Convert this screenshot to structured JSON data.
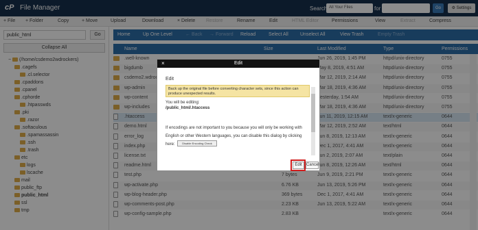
{
  "header": {
    "logo": "cP",
    "title": "File Manager",
    "search_label": "Search",
    "search_scope": "All Your Files",
    "for_label": "for",
    "go": "Go",
    "settings": "Settings"
  },
  "toolbar": [
    "+ File",
    "+ Folder",
    "Copy",
    "+ Move",
    "Upload",
    "Download",
    "× Delete",
    "Restore",
    "Rename",
    "Edit",
    "HTML Editor",
    "Permissions",
    "View",
    "Extract",
    "Compress"
  ],
  "sidebar": {
    "path": "public_html",
    "go": "Go",
    "collapse": "Collapse All",
    "tree": [
      "(/home/csdemo2wdrockers)",
      ".cagefs",
      ".cl.selector",
      ".cpaddons",
      ".cpanel",
      ".cphorde",
      ".htpasswds",
      ".pki",
      ".razor",
      ".softaculous",
      ".spamassassin",
      ".ssh",
      ".trash",
      "etc",
      "logs",
      "lscache",
      "mail",
      "public_ftp",
      "public_html",
      "ssl",
      "tmp"
    ]
  },
  "actions": [
    "Home",
    "Up One Level",
    "← Back",
    "→ Forward",
    "Reload",
    "Select All",
    "Unselect All",
    "View Trash",
    "Empty Trash"
  ],
  "table": {
    "headers": [
      "Name",
      "Size",
      "Last Modified",
      "Type",
      "Permissions"
    ],
    "rows": [
      {
        "name": ".well-known",
        "size": "",
        "modified": "Jun 26, 2019, 1:45 PM",
        "type": "httpd/unix-directory",
        "perm": "0755"
      },
      {
        "name": "bigdumb",
        "size": "",
        "modified": "May 8, 2019, 4:51 AM",
        "type": "httpd/unix-directory",
        "perm": "0755"
      },
      {
        "name": "csdemo2.wdroc",
        "size": "",
        "modified": "Mar 12, 2019, 2:14 AM",
        "type": "httpd/unix-directory",
        "perm": "0755"
      },
      {
        "name": "wp-admin",
        "size": "",
        "modified": "Mar 18, 2019, 4:36 AM",
        "type": "httpd/unix-directory",
        "perm": "0755"
      },
      {
        "name": "wp-content",
        "size": "",
        "modified": "Yesterday, 1:54 AM",
        "type": "httpd/unix-directory",
        "perm": "0755"
      },
      {
        "name": "wp-includes",
        "size": "",
        "modified": "Mar 18, 2019, 4:36 AM",
        "type": "httpd/unix-directory",
        "perm": "0755"
      },
      {
        "name": ".htaccess",
        "size": "",
        "modified": "Jun 11, 2019, 12:15 AM",
        "type": "text/x-generic",
        "perm": "0644"
      },
      {
        "name": "demo.html",
        "size": "",
        "modified": "Mar 12, 2019, 2:52 AM",
        "type": "text/html",
        "perm": "0644"
      },
      {
        "name": "error_log",
        "size": "",
        "modified": "Jun 8, 2019, 12:13 AM",
        "type": "text/x-generic",
        "perm": "0644"
      },
      {
        "name": "index.php",
        "size": "",
        "modified": "Dec 1, 2017, 4:41 AM",
        "type": "text/x-generic",
        "perm": "0644"
      },
      {
        "name": "license.txt",
        "size": "",
        "modified": "Jun 2, 2019, 2:07 AM",
        "type": "text/plain",
        "perm": "0644"
      },
      {
        "name": "readme.html",
        "size": "7.29 KB",
        "modified": "Jun 8, 2019, 12:26 AM",
        "type": "text/html",
        "perm": "0644"
      },
      {
        "name": "test.php",
        "size": "7 bytes",
        "modified": "Jun 9, 2019, 2:21 PM",
        "type": "text/x-generic",
        "perm": "0644"
      },
      {
        "name": "wp-activate.php",
        "size": "6.76 KB",
        "modified": "Jun 13, 2019, 5:26 PM",
        "type": "text/x-generic",
        "perm": "0644"
      },
      {
        "name": "wp-blog-header.php",
        "size": "369 bytes",
        "modified": "Dec 1, 2017, 4:41 AM",
        "type": "text/x-generic",
        "perm": "0644"
      },
      {
        "name": "wp-comments-post.php",
        "size": "2.23 KB",
        "modified": "Jun 13, 2019, 5:22 AM",
        "type": "text/x-generic",
        "perm": "0644"
      },
      {
        "name": "wp-config-sample.php",
        "size": "2.83 KB",
        "modified": "",
        "type": "text/x-generic",
        "perm": "0644"
      }
    ]
  },
  "modal": {
    "header": "Edit",
    "close": "×",
    "title": "Edit",
    "warning": "Back up the original file before converting character sets, since this action can produce unexpected results.",
    "will_edit": "You will be editing:",
    "path": "/public_html/.htaccess",
    "encoding_text": "If encodings are not important to you because you will only be working with English or other Western languages, you can disable this dialog by clicking here:",
    "disable_btn": "Disable Encoding Check",
    "edit": "Edit",
    "cancel": "Cancel"
  }
}
